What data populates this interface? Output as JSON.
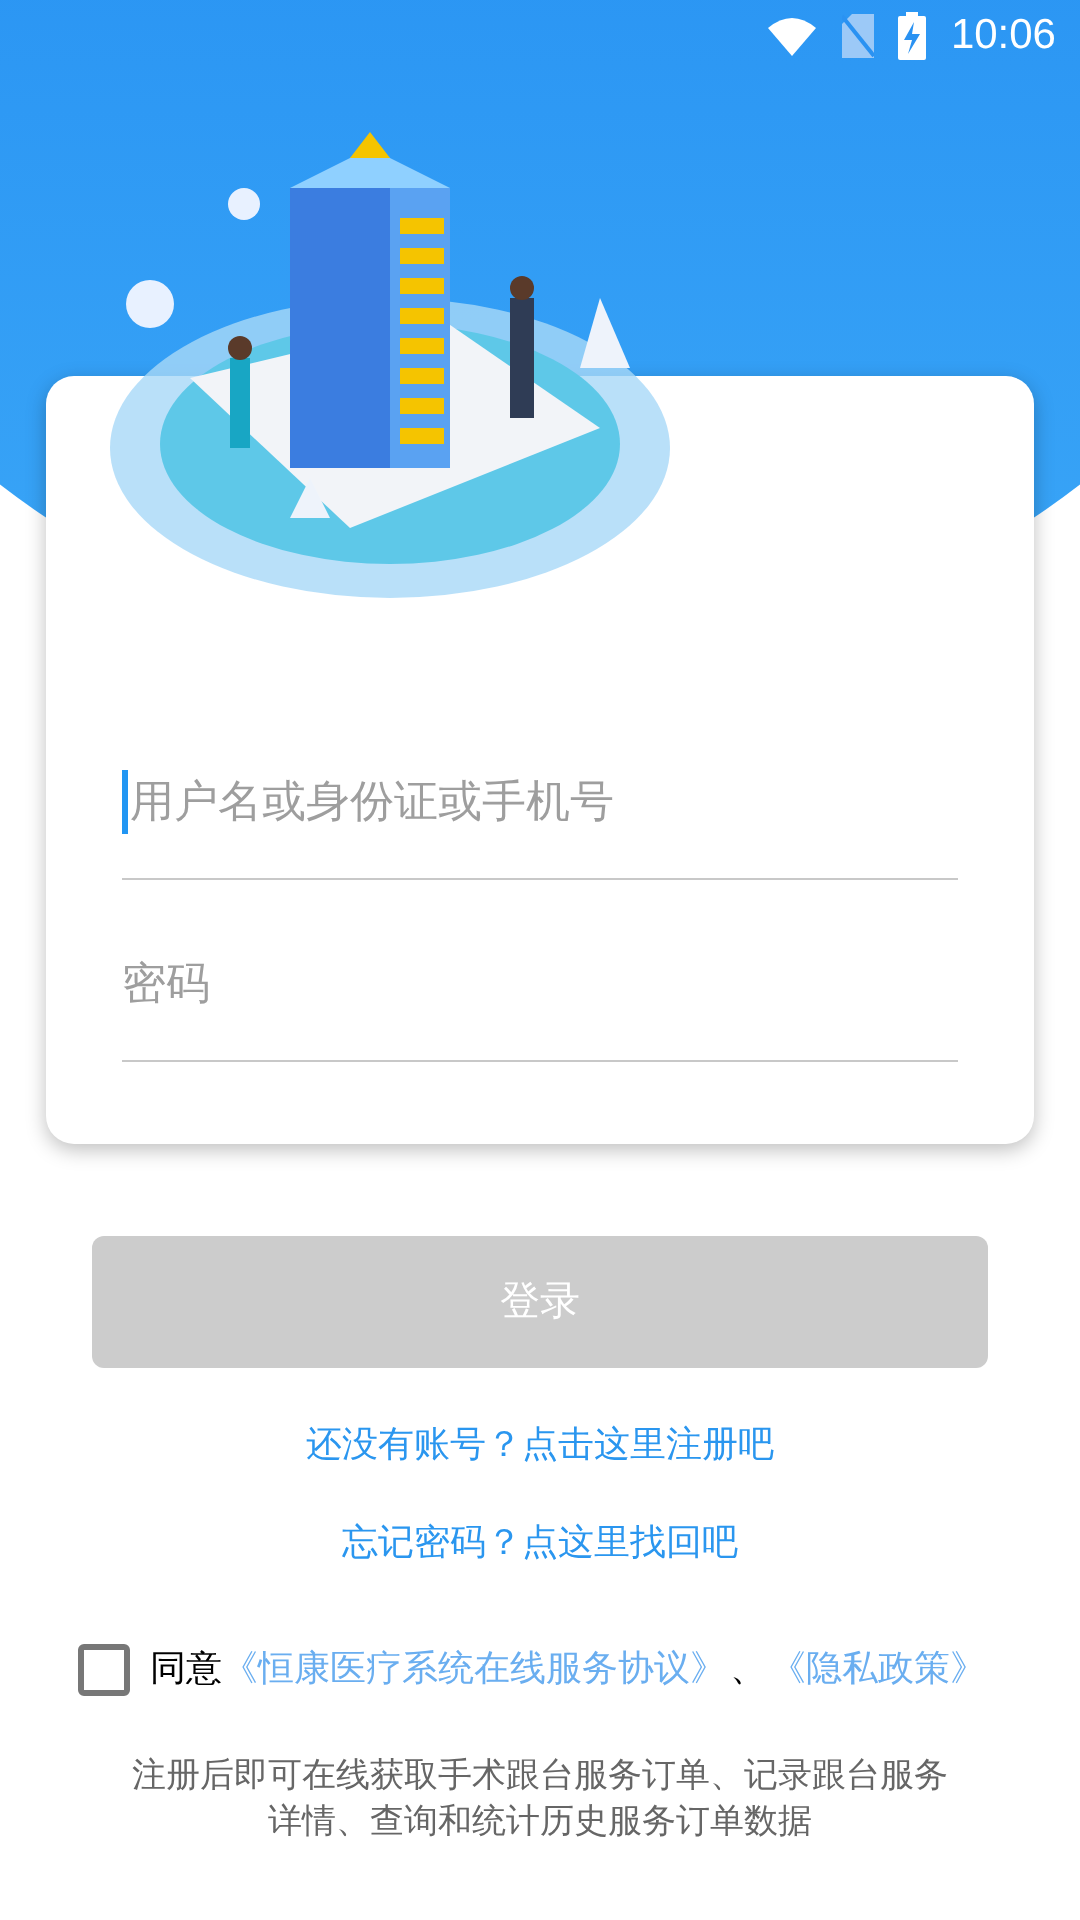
{
  "status_bar": {
    "time": "10:06"
  },
  "login_form": {
    "username": {
      "placeholder": "用户名或身份证或手机号",
      "focused": true
    },
    "password": {
      "placeholder": "密码"
    }
  },
  "login_button": {
    "label": "登录",
    "disabled": true
  },
  "links": [
    "还没有账号？点击这里注册吧",
    "忘记密码？点这里找回吧"
  ],
  "agreement": {
    "checked": false,
    "prefix": "同意",
    "links": [
      "《恒康医疗系统在线服务协议》",
      "《隐私政策》"
    ],
    "separator": "、"
  },
  "note": "注册后即可在线获取手术跟台服务订单、记录跟台服务详情、查询和统计历史服务订单数据"
}
